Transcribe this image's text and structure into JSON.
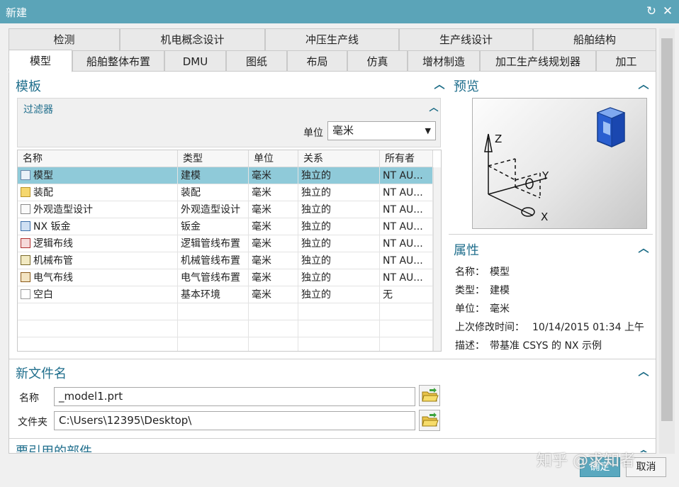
{
  "window": {
    "title": "新建"
  },
  "tabs_row1": [
    "检测",
    "机电概念设计",
    "冲压生产线",
    "生产线设计",
    "船舶结构"
  ],
  "tabs_row2": [
    "模型",
    "船舶整体布置",
    "DMU",
    "图纸",
    "布局",
    "仿真",
    "增材制造",
    "加工生产线规划器",
    "加工"
  ],
  "template": {
    "title": "模板",
    "filter_title": "过滤器",
    "unit_label": "单位",
    "unit_value": "毫米",
    "columns": [
      "名称",
      "类型",
      "单位",
      "关系",
      "所有者"
    ],
    "rows": [
      {
        "icon": "model-icon",
        "name": "模型",
        "type": "建模",
        "unit": "毫米",
        "relation": "独立的",
        "owner": "NT AU..."
      },
      {
        "icon": "assembly-icon",
        "name": "装配",
        "type": "装配",
        "unit": "毫米",
        "relation": "独立的",
        "owner": "NT AU..."
      },
      {
        "icon": "shape-design-icon",
        "name": "外观造型设计",
        "type": "外观造型设计",
        "unit": "毫米",
        "relation": "独立的",
        "owner": "NT AU..."
      },
      {
        "icon": "sheet-metal-icon",
        "name": "NX 钣金",
        "type": "钣金",
        "unit": "毫米",
        "relation": "独立的",
        "owner": "NT AU..."
      },
      {
        "icon": "logical-routing-icon",
        "name": "逻辑布线",
        "type": "逻辑管线布置",
        "unit": "毫米",
        "relation": "独立的",
        "owner": "NT AU..."
      },
      {
        "icon": "mechanical-routing-icon",
        "name": "机械布管",
        "type": "机械管线布置",
        "unit": "毫米",
        "relation": "独立的",
        "owner": "NT AU..."
      },
      {
        "icon": "electrical-routing-icon",
        "name": "电气布线",
        "type": "电气管线布置",
        "unit": "毫米",
        "relation": "独立的",
        "owner": "NT AU..."
      },
      {
        "icon": "blank-icon",
        "name": "空白",
        "type": "基本环境",
        "unit": "毫米",
        "relation": "独立的",
        "owner": "无"
      }
    ]
  },
  "preview": {
    "title": "预览",
    "axis_labels": {
      "z": "Z",
      "y": "Y",
      "x": "X"
    }
  },
  "properties": {
    "title": "属性",
    "name_label": "名称：",
    "name_value": "模型",
    "type_label": "类型：",
    "type_value": "建模",
    "unit_label": "单位：",
    "unit_value": "毫米",
    "modified_label": "上次修改时间：",
    "modified_value": "10/14/2015 01:34 上午",
    "desc_label": "描述：",
    "desc_value": "带基准 CSYS 的 NX 示例"
  },
  "new_file": {
    "title": "新文件名",
    "name_label": "名称",
    "name_value": "_model1.prt",
    "folder_label": "文件夹",
    "folder_value": "C:\\Users\\12395\\Desktop\\"
  },
  "referenced_part": {
    "title": "要引用的部件"
  },
  "buttons": {
    "ok": "确定",
    "cancel": "取消"
  },
  "watermark": "知乎 @求知者",
  "colors": {
    "titlebar": "#5ba4b8",
    "selection": "#8fcad9",
    "section_title": "#1f6e8c"
  }
}
